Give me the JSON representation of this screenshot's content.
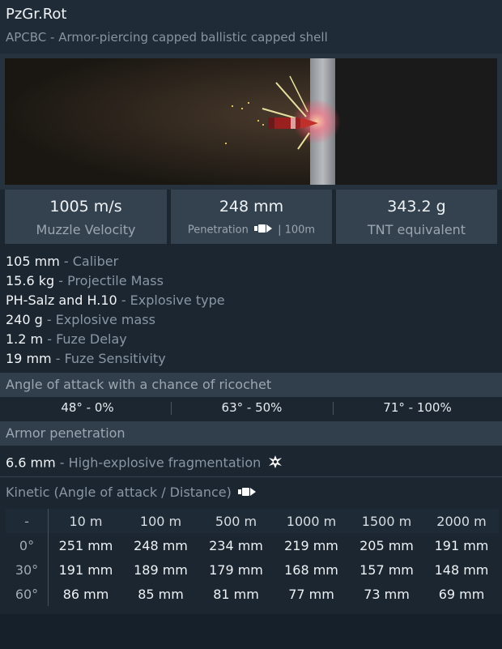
{
  "header": {
    "title": "PzGr.Rot",
    "subtitle": "APCBC - Armor-piercing capped ballistic capped shell"
  },
  "stats": {
    "velocity": {
      "value": "1005 m/s",
      "label": "Muzzle Velocity"
    },
    "penetration": {
      "value": "248 mm",
      "label": "Penetration",
      "suffix": "| 100m",
      "icon": "shell-icon"
    },
    "tnt": {
      "value": "343.2 g",
      "label": "TNT equivalent"
    }
  },
  "properties": [
    {
      "value": "105 mm",
      "desc": " - Caliber"
    },
    {
      "value": "15.6 kg",
      "desc": " - Projectile Mass"
    },
    {
      "value": "PH-Salz and H.10",
      "desc": " - Explosive type"
    },
    {
      "value": "240 g",
      "desc": " - Explosive mass"
    },
    {
      "value": "1.2 m",
      "desc": " - Fuze Delay"
    },
    {
      "value": "19 mm",
      "desc": " - Fuze Sensitivity"
    }
  ],
  "ricochet": {
    "title": "Angle of attack with a chance of ricochet",
    "values": [
      "48° - 0%",
      "63° - 50%",
      "71° - 100%"
    ]
  },
  "armor": {
    "title": "Armor penetration",
    "fragmentation": {
      "value": "6.6 mm",
      "desc": " - High-explosive fragmentation",
      "icon": "explosion-icon"
    },
    "kinetic_title": "Kinetic (Angle of attack / Distance)",
    "kinetic_icon": "shell-icon",
    "table": {
      "headers": [
        "-",
        "10 m",
        "100 m",
        "500 m",
        "1000 m",
        "1500 m",
        "2000 m"
      ],
      "rows": [
        {
          "angle": "0°",
          "cells": [
            "251 mm",
            "248 mm",
            "234 mm",
            "219 mm",
            "205 mm",
            "191 mm"
          ]
        },
        {
          "angle": "30°",
          "cells": [
            "191 mm",
            "189 mm",
            "179 mm",
            "168 mm",
            "157 mm",
            "148 mm"
          ]
        },
        {
          "angle": "60°",
          "cells": [
            "86 mm",
            "85 mm",
            "81 mm",
            "77 mm",
            "73 mm",
            "69 mm"
          ]
        }
      ]
    }
  }
}
